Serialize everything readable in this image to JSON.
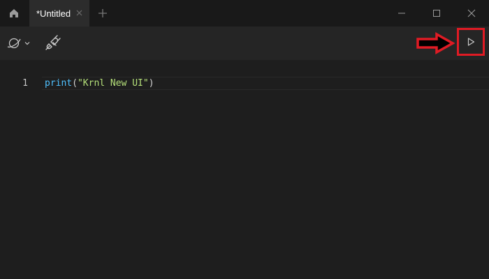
{
  "titlebar": {
    "home_icon": "home-icon",
    "tabs": [
      {
        "label": "*Untitled",
        "close_icon": "close-icon"
      }
    ],
    "new_tab_icon": "plus-icon",
    "window_controls": [
      "minimize-icon",
      "maximize-icon",
      "close-icon"
    ]
  },
  "toolbar": {
    "left_icons": [
      "planet-icon",
      "chevron-down-icon",
      "plug-icon"
    ],
    "run_icon": "play-icon"
  },
  "annotation": {
    "arrow_color": "#e01b24",
    "box_color": "#e01b24"
  },
  "editor": {
    "lines": [
      {
        "number": "1",
        "tokens": {
          "fn": "print",
          "open": "(",
          "string": "\"Krnl New UI\"",
          "close": ")"
        }
      }
    ]
  },
  "colors": {
    "background": "#1e1e1e",
    "titlebar": "#191919",
    "toolbar": "#252525",
    "active_tab": "#2c2c2c",
    "function": "#4fc1ff",
    "string": "#b5e07a"
  }
}
